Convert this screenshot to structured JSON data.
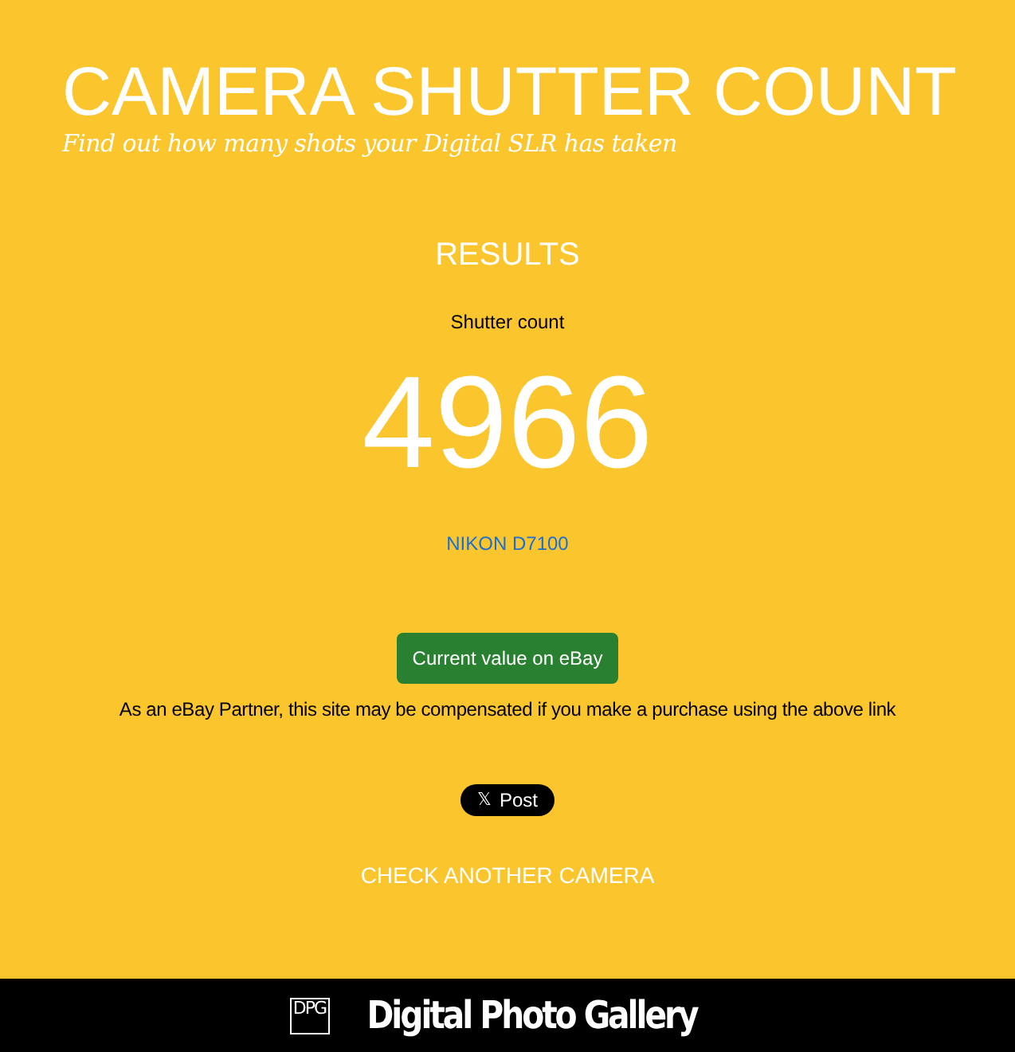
{
  "header": {
    "title": "CAMERA SHUTTER COUNT",
    "tagline": "Find out how many shots your Digital SLR has taken"
  },
  "results": {
    "heading": "RESULTS",
    "label": "Shutter count",
    "count": "4966",
    "camera": "NIKON D7100"
  },
  "ebay": {
    "button": "Current value on eBay",
    "disclaimer": "As an eBay Partner, this site may be compensated if you make a purchase using the above link"
  },
  "share": {
    "icon": "𝕏",
    "label": "Post"
  },
  "check_another": "CHECK ANOTHER CAMERA",
  "footer": {
    "logo_mark": "DPG",
    "logo_text": "Digital Photo Gallery"
  }
}
